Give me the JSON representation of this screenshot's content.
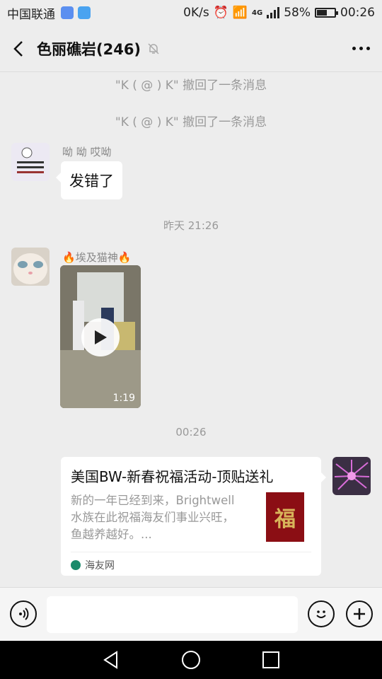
{
  "status": {
    "carrier": "中国联通",
    "speed": "0K/s",
    "network": "4G",
    "battery": "58%",
    "time": "00:26"
  },
  "header": {
    "title": "色丽礁岩(246)"
  },
  "messages": {
    "recall1": "\"K ( @ ) K\" 撤回了一条消息",
    "recall2": "\"K ( @ ) K\" 撤回了一条消息",
    "sender1": "呦 呦 哎呦",
    "msg1": "发错了",
    "time1": "昨天 21:26",
    "sender2": "埃及猫神",
    "video_duration": "1:19",
    "time2": "00:26",
    "card": {
      "title": "美国BW-新春祝福活动-顶贴送礼",
      "desc": "新的一年已经到来，Brightwell水族在此祝福海友们事业兴旺，鱼越养越好。...",
      "source": "海友网",
      "thumb_text": "福"
    }
  },
  "icons": {
    "back": "back-arrow-icon",
    "mute": "mute-bell-icon",
    "more": "more-icon",
    "voice": "voice-icon",
    "emoji": "emoji-icon",
    "plus": "plus-icon"
  }
}
